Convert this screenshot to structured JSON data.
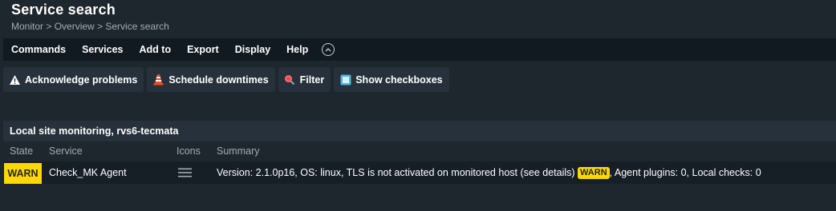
{
  "header": {
    "title": "Service search",
    "breadcrumb": "Monitor > Overview > Service search"
  },
  "menubar": {
    "items": [
      "Commands",
      "Services",
      "Add to",
      "Export",
      "Display",
      "Help"
    ]
  },
  "toolbar": {
    "acknowledge_label": "Acknowledge problems",
    "schedule_label": "Schedule downtimes",
    "filter_label": "Filter",
    "checkbox_label": "Show checkboxes"
  },
  "table": {
    "group_title": "Local site monitoring, rvs6-tecmata",
    "columns": [
      "State",
      "Service",
      "Icons",
      "Summary"
    ],
    "rows": [
      {
        "state": "WARN",
        "service": "Check_MK Agent",
        "summary_before": "Version: 2.1.0p16, OS: linux, TLS is not activated on monitored host (see details)",
        "summary_badge": "WARN",
        "summary_after": ", Agent plugins: 0, Local checks: 0"
      }
    ]
  },
  "colors": {
    "background": "#1e262e",
    "menubar": "#121a21",
    "button": "#27313b",
    "warn": "#ffd703"
  }
}
